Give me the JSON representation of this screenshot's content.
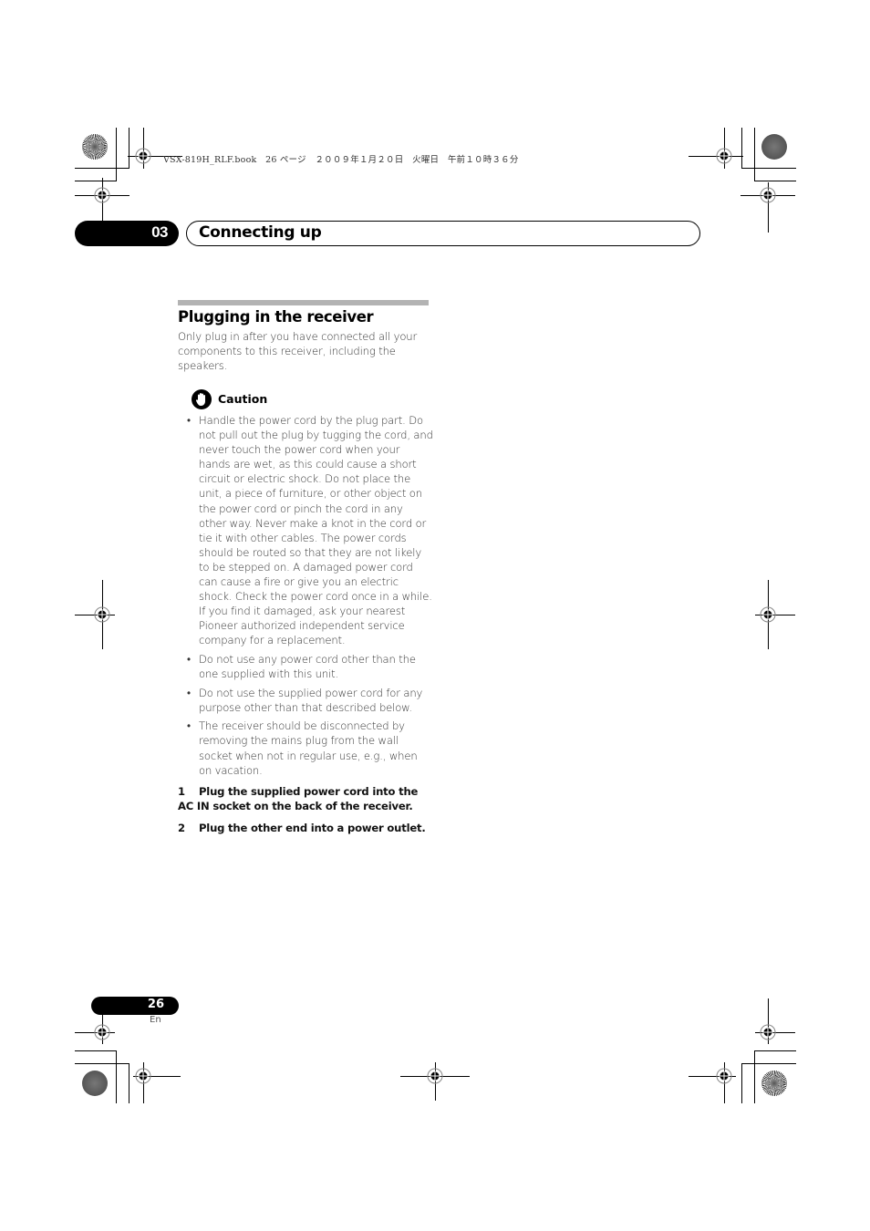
{
  "file_stamp": "VSX-819H_RLF.book　26 ページ　２００９年１月２０日　火曜日　午前１０時３６分",
  "chapter": {
    "number": "03",
    "title": "Connecting up"
  },
  "section": {
    "heading": "Plugging in the receiver",
    "intro": "Only plug in after you have connected all your components to this receiver, including the speakers."
  },
  "caution": {
    "icon": "hand-stop-icon",
    "label": "Caution",
    "bullet_glyph": "•",
    "items": [
      "Handle the power cord by the plug part. Do not pull out the plug by tugging the cord, and never touch the power cord when your hands are wet, as this could cause a short circuit or electric shock. Do not place the unit, a piece of furniture, or other object on the power cord or pinch the cord in any other way. Never make a knot in the cord or tie it with other cables. The power cords should be routed so that they are not likely to be stepped on. A damaged power cord can cause a fire or give you an electric shock. Check the power cord once in a while. If you find it damaged, ask your nearest Pioneer authorized independent service company for a replacement.",
      "Do not use any power cord other than the one supplied with this unit.",
      "Do not use the supplied power cord for any purpose other than that described below.",
      "The receiver should be disconnected by removing the mains plug from the wall socket when not in regular use, e.g., when on vacation."
    ]
  },
  "steps": [
    {
      "number": "1",
      "text": "Plug the supplied power cord into the AC IN socket on the back of the receiver."
    },
    {
      "number": "2",
      "text": "Plug the other end into a power outlet."
    }
  ],
  "footer": {
    "page_number": "26",
    "language": "En"
  },
  "print_marks": {
    "registration_icon": "registration-mark-icon",
    "color_disc_icon": "color-disc-icon"
  }
}
